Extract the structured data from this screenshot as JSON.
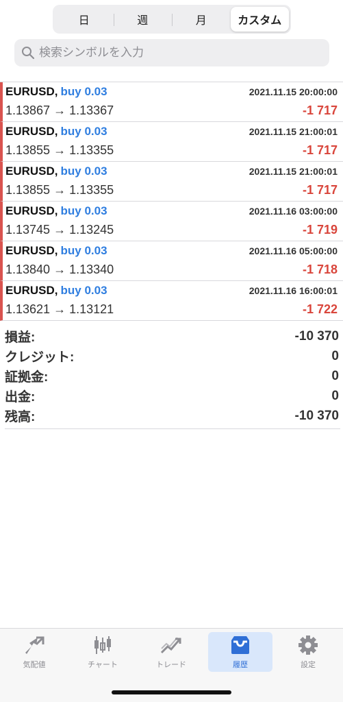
{
  "periods": {
    "day": "日",
    "week": "週",
    "month": "月",
    "custom": "カスタム",
    "selected": "カスタム"
  },
  "search": {
    "placeholder": "検索シンボルを入力",
    "icon": "search-icon"
  },
  "trades": [
    {
      "symbol": "EURUSD,",
      "side": "buy 0.03",
      "datetime": "2021.11.15 20:00:00",
      "prices": "1.13867 → 1.13367",
      "profit": "-1 717"
    },
    {
      "symbol": "EURUSD,",
      "side": "buy 0.03",
      "datetime": "2021.11.15 21:00:01",
      "prices": "1.13855 → 1.13355",
      "profit": "-1 717"
    },
    {
      "symbol": "EURUSD,",
      "side": "buy 0.03",
      "datetime": "2021.11.15 21:00:01",
      "prices": "1.13855 → 1.13355",
      "profit": "-1 717"
    },
    {
      "symbol": "EURUSD,",
      "side": "buy 0.03",
      "datetime": "2021.11.16 03:00:00",
      "prices": "1.13745 → 1.13245",
      "profit": "-1 719"
    },
    {
      "symbol": "EURUSD,",
      "side": "buy 0.03",
      "datetime": "2021.11.16 05:00:00",
      "prices": "1.13840 → 1.13340",
      "profit": "-1 718"
    },
    {
      "symbol": "EURUSD,",
      "side": "buy 0.03",
      "datetime": "2021.11.16 16:00:01",
      "prices": "1.13621 → 1.13121",
      "profit": "-1 722"
    }
  ],
  "summary": {
    "profit_label": "損益:",
    "profit": "-10 370",
    "credit_label": "クレジット:",
    "credit": "0",
    "margin_label": "証拠金:",
    "margin": "0",
    "withdrawal_label": "出金:",
    "withdrawal": "0",
    "balance_label": "残高:",
    "balance": "-10 370"
  },
  "tabs": [
    {
      "label": "気配値",
      "icon": "quotes-icon"
    },
    {
      "label": "チャート",
      "icon": "chart-icon"
    },
    {
      "label": "トレード",
      "icon": "trade-icon"
    },
    {
      "label": "履歴",
      "icon": "history-icon",
      "active": true
    },
    {
      "label": "設定",
      "icon": "settings-icon"
    }
  ],
  "colors": {
    "loss": "#d9453b",
    "buy": "#2f7ee0",
    "accent": "#2f6fd6",
    "row_marker": "#d9534f"
  }
}
